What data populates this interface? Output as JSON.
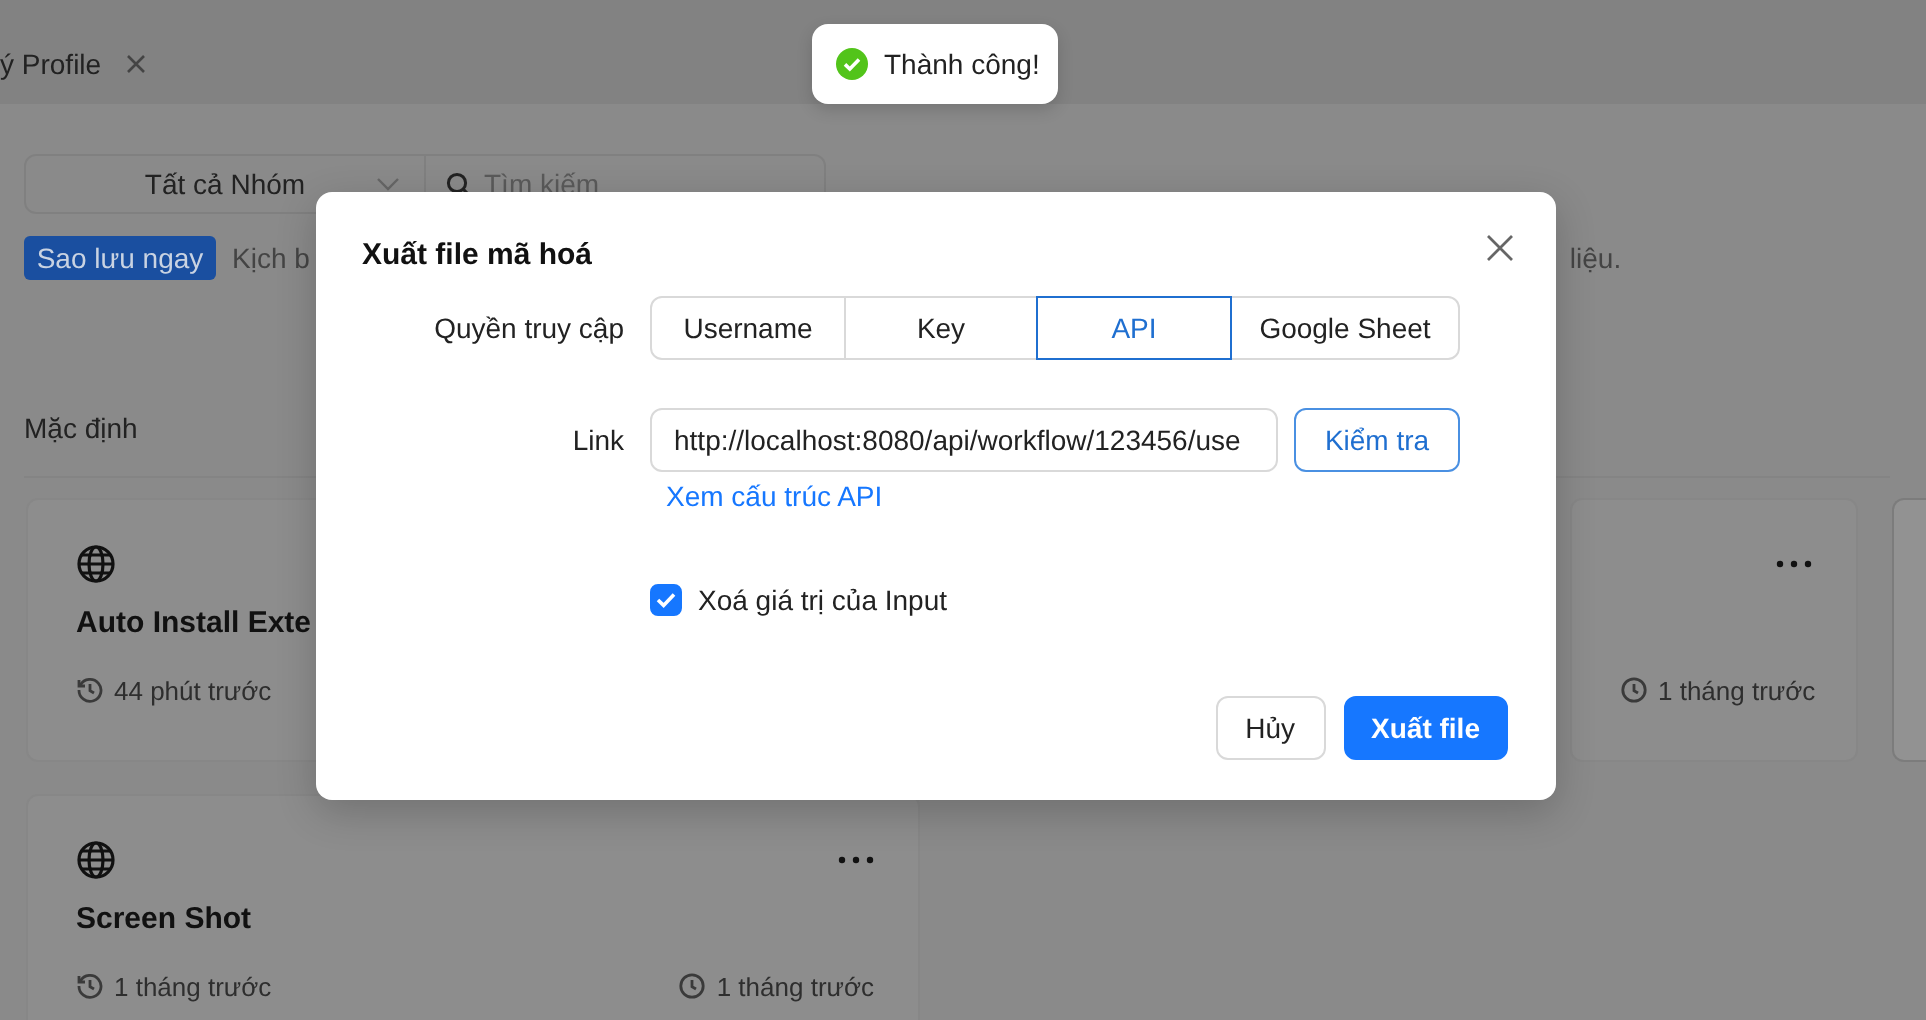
{
  "toast": {
    "message": "Thành công!"
  },
  "tab_bar": {
    "tabs": [
      {
        "label": "ý Profile"
      }
    ]
  },
  "toolbar": {
    "group_select": "Tất cả Nhóm",
    "search": {
      "placeholder": "Tìm kiếm"
    },
    "backup_button": "Sao lưu ngay",
    "note_start": "Kịch b",
    "note_end": "liệu."
  },
  "section_title": "Mặc định",
  "cards": [
    {
      "title": "Auto Install Exte",
      "left_time": "44 phút trước"
    },
    {
      "right_time": "1 tháng trước",
      "menu": true
    },
    {
      "title": "Screen Shot",
      "left_time": "1 tháng trước",
      "right_time": "1 tháng trước",
      "menu": true
    }
  ],
  "dialog": {
    "title": "Xuất file mã hoá",
    "access_label": "Quyền truy cập",
    "access_options": [
      {
        "label": "Username",
        "selected": false
      },
      {
        "label": "Key",
        "selected": false
      },
      {
        "label": "API",
        "selected": true
      },
      {
        "label": "Google Sheet",
        "selected": false
      }
    ],
    "link_label": "Link",
    "link_value": "http://localhost:8080/api/workflow/123456/use",
    "check_button": "Kiểm tra",
    "api_link": "Xem cấu trúc API",
    "clear_input": {
      "label": "Xoá giá trị của Input",
      "checked": true
    },
    "buttons": [
      {
        "label": "Hủy",
        "kind": "default"
      },
      {
        "label": "Xuất file",
        "kind": "primary"
      }
    ]
  }
}
